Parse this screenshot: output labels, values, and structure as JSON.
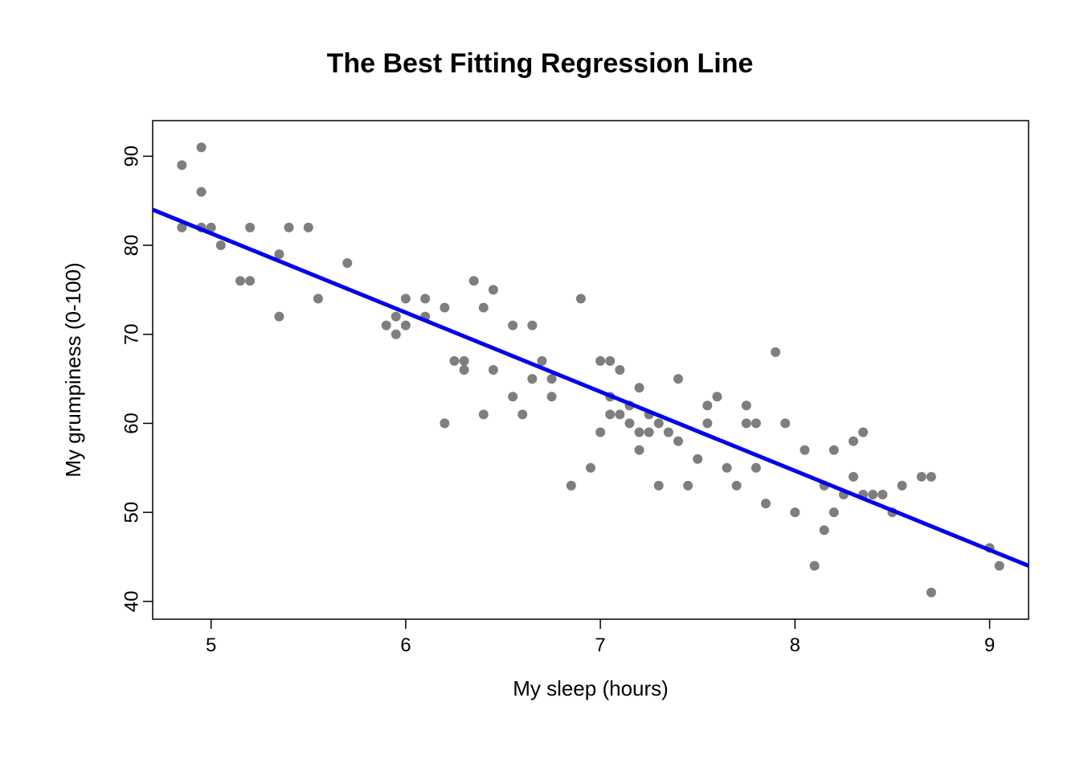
{
  "chart_data": {
    "type": "scatter",
    "title": "The Best Fitting Regression Line",
    "xlabel": "My sleep (hours)",
    "ylabel": "My grumpiness (0-100)",
    "xlim": [
      4.7,
      9.2
    ],
    "ylim": [
      38,
      94
    ],
    "xticks": [
      5,
      6,
      7,
      8,
      9
    ],
    "yticks": [
      40,
      50,
      60,
      70,
      80,
      90
    ],
    "points": [
      {
        "x": 4.85,
        "y": 89
      },
      {
        "x": 4.95,
        "y": 91
      },
      {
        "x": 4.95,
        "y": 86
      },
      {
        "x": 4.85,
        "y": 82
      },
      {
        "x": 4.95,
        "y": 82
      },
      {
        "x": 5.0,
        "y": 82
      },
      {
        "x": 5.05,
        "y": 80
      },
      {
        "x": 5.15,
        "y": 76
      },
      {
        "x": 5.2,
        "y": 82
      },
      {
        "x": 5.2,
        "y": 76
      },
      {
        "x": 5.35,
        "y": 72
      },
      {
        "x": 5.35,
        "y": 79
      },
      {
        "x": 5.4,
        "y": 82
      },
      {
        "x": 5.5,
        "y": 82
      },
      {
        "x": 5.55,
        "y": 74
      },
      {
        "x": 5.7,
        "y": 78
      },
      {
        "x": 5.9,
        "y": 71
      },
      {
        "x": 5.95,
        "y": 70
      },
      {
        "x": 5.95,
        "y": 72
      },
      {
        "x": 6.0,
        "y": 74
      },
      {
        "x": 6.0,
        "y": 71
      },
      {
        "x": 6.1,
        "y": 72
      },
      {
        "x": 6.1,
        "y": 74
      },
      {
        "x": 6.2,
        "y": 73
      },
      {
        "x": 6.2,
        "y": 60
      },
      {
        "x": 6.25,
        "y": 67
      },
      {
        "x": 6.3,
        "y": 67
      },
      {
        "x": 6.3,
        "y": 66
      },
      {
        "x": 6.35,
        "y": 76
      },
      {
        "x": 6.4,
        "y": 73
      },
      {
        "x": 6.4,
        "y": 61
      },
      {
        "x": 6.45,
        "y": 66
      },
      {
        "x": 6.45,
        "y": 75
      },
      {
        "x": 6.55,
        "y": 71
      },
      {
        "x": 6.55,
        "y": 63
      },
      {
        "x": 6.6,
        "y": 61
      },
      {
        "x": 6.65,
        "y": 65
      },
      {
        "x": 6.65,
        "y": 71
      },
      {
        "x": 6.7,
        "y": 67
      },
      {
        "x": 6.75,
        "y": 65
      },
      {
        "x": 6.75,
        "y": 63
      },
      {
        "x": 6.85,
        "y": 53
      },
      {
        "x": 6.9,
        "y": 74
      },
      {
        "x": 6.95,
        "y": 55
      },
      {
        "x": 7.0,
        "y": 67
      },
      {
        "x": 7.0,
        "y": 59
      },
      {
        "x": 7.05,
        "y": 67
      },
      {
        "x": 7.05,
        "y": 61
      },
      {
        "x": 7.05,
        "y": 63
      },
      {
        "x": 7.1,
        "y": 61
      },
      {
        "x": 7.1,
        "y": 66
      },
      {
        "x": 7.15,
        "y": 62
      },
      {
        "x": 7.15,
        "y": 60
      },
      {
        "x": 7.2,
        "y": 64
      },
      {
        "x": 7.2,
        "y": 57
      },
      {
        "x": 7.2,
        "y": 59
      },
      {
        "x": 7.25,
        "y": 61
      },
      {
        "x": 7.25,
        "y": 59
      },
      {
        "x": 7.3,
        "y": 60
      },
      {
        "x": 7.3,
        "y": 53
      },
      {
        "x": 7.35,
        "y": 59
      },
      {
        "x": 7.4,
        "y": 58
      },
      {
        "x": 7.4,
        "y": 65
      },
      {
        "x": 7.45,
        "y": 53
      },
      {
        "x": 7.5,
        "y": 56
      },
      {
        "x": 7.55,
        "y": 62
      },
      {
        "x": 7.55,
        "y": 60
      },
      {
        "x": 7.6,
        "y": 63
      },
      {
        "x": 7.65,
        "y": 55
      },
      {
        "x": 7.7,
        "y": 53
      },
      {
        "x": 7.75,
        "y": 62
      },
      {
        "x": 7.75,
        "y": 60
      },
      {
        "x": 7.8,
        "y": 55
      },
      {
        "x": 7.8,
        "y": 60
      },
      {
        "x": 7.85,
        "y": 51
      },
      {
        "x": 7.9,
        "y": 68
      },
      {
        "x": 7.95,
        "y": 60
      },
      {
        "x": 8.0,
        "y": 50
      },
      {
        "x": 8.05,
        "y": 57
      },
      {
        "x": 8.1,
        "y": 44
      },
      {
        "x": 8.15,
        "y": 53
      },
      {
        "x": 8.15,
        "y": 48
      },
      {
        "x": 8.2,
        "y": 57
      },
      {
        "x": 8.2,
        "y": 50
      },
      {
        "x": 8.25,
        "y": 52
      },
      {
        "x": 8.3,
        "y": 54
      },
      {
        "x": 8.3,
        "y": 58
      },
      {
        "x": 8.35,
        "y": 52
      },
      {
        "x": 8.35,
        "y": 59
      },
      {
        "x": 8.4,
        "y": 52
      },
      {
        "x": 8.45,
        "y": 52
      },
      {
        "x": 8.5,
        "y": 50
      },
      {
        "x": 8.55,
        "y": 53
      },
      {
        "x": 8.65,
        "y": 54
      },
      {
        "x": 8.7,
        "y": 41
      },
      {
        "x": 8.7,
        "y": 54
      },
      {
        "x": 9.0,
        "y": 46
      },
      {
        "x": 9.05,
        "y": 44
      }
    ],
    "regression": {
      "x1": 4.7,
      "y1": 84.0,
      "x2": 9.2,
      "y2": 44.0
    },
    "colors": {
      "points": "#707070",
      "line": "#0000ee"
    }
  }
}
